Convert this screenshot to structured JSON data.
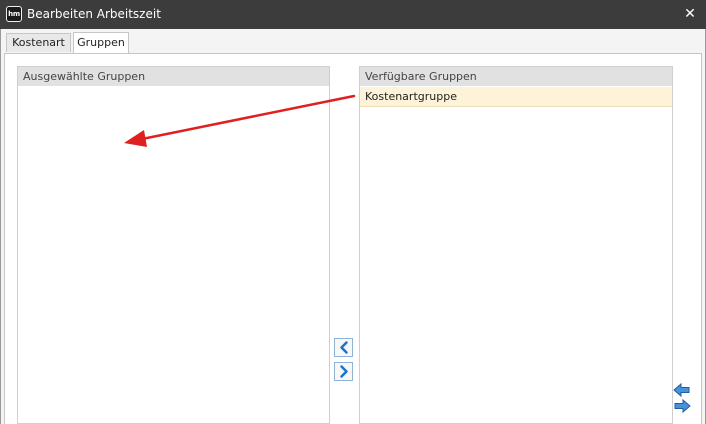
{
  "window": {
    "app_icon_text": "hm",
    "title": "Bearbeiten Arbeitszeit",
    "close_glyph": "✕"
  },
  "tabs": [
    {
      "label": "Kostenart",
      "active": false
    },
    {
      "label": "Gruppen",
      "active": true
    }
  ],
  "selected_groups": {
    "header": "Ausgewählte Gruppen",
    "items": []
  },
  "available_groups": {
    "header": "Verfügbare Gruppen",
    "items": [
      {
        "label": "Kostenartgruppe",
        "selected": true
      }
    ]
  },
  "buttons": {
    "move_left_icon": "chevron-left-icon",
    "move_right_icon": "chevron-right-icon",
    "swap_icon": "swap-arrows-icon"
  },
  "colors": {
    "titlebar": "#3c3c3c",
    "header_bg": "#e1e1e1",
    "selected_row": "#fdf3d8",
    "button_arrow": "#1a73c9",
    "annotation_arrow": "#e02020"
  }
}
